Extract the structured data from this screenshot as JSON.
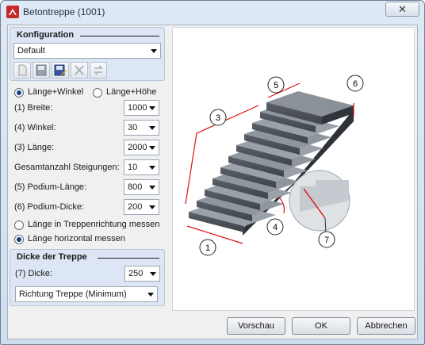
{
  "window": {
    "title": "Betontreppe (1001)",
    "close_glyph": "✕"
  },
  "config": {
    "group_title": "Konfiguration",
    "selected": "Default",
    "toolbar_icons": [
      "new-icon",
      "save-icon",
      "save-as-icon",
      "delete-icon",
      "refresh-icon"
    ]
  },
  "mode": {
    "option_1": "Länge+Winkel",
    "option_2": "Länge+Höhe",
    "selected": "Länge+Winkel"
  },
  "params": [
    {
      "label": "(1) Breite:",
      "value": "1000"
    },
    {
      "label": "(4) Winkel:",
      "value": "30"
    },
    {
      "label": "(3) Länge:",
      "value": "2000"
    },
    {
      "label": "Gesamtanzahl Steigungen:",
      "value": "10"
    },
    {
      "label": "(5) Podium-Länge:",
      "value": "800"
    },
    {
      "label": "(6) Podium-Dicke:",
      "value": "200"
    }
  ],
  "measure": {
    "option_1": "Länge in Treppenrichtung messen",
    "option_2": "Länge horizontal messen",
    "selected": "Länge horizontal messen"
  },
  "thickness": {
    "group_title": "Dicke der Treppe",
    "label": "(7) Dicke:",
    "value": "250",
    "direction": "Richtung Treppe (Minimum)"
  },
  "preview": {
    "callouts": [
      "1",
      "3",
      "4",
      "5",
      "6",
      "7"
    ]
  },
  "buttons": {
    "preview": "Vorschau",
    "ok": "OK",
    "cancel": "Abbrechen"
  }
}
